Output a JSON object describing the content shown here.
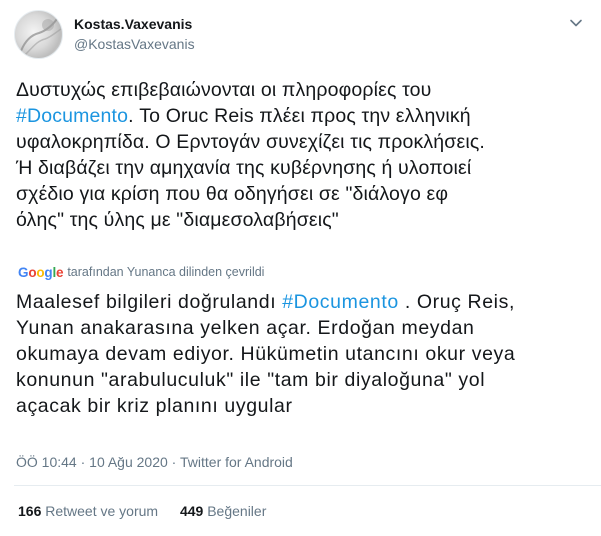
{
  "author": {
    "display_name": "Kostas.Vaxevanis",
    "handle": "@KostasVaxevanis"
  },
  "tweet": {
    "lines": [
      {
        "pre": "Δυστυχώς επιβεβαιώνονται οι πληροφορίες του",
        "tag": "",
        "post": ""
      },
      {
        "pre": "",
        "tag": "#Documento",
        "post": ". Το Oruc Reis πλέει προς την ελληνική"
      },
      {
        "pre": "υφαλοκρηπίδα. Ο Ερντογάν συνεχίζει τις προκλήσεις.",
        "tag": "",
        "post": ""
      },
      {
        "pre": "Ή διαβάζει την αμηχανία της κυβέρνησης ή υλοποιεί",
        "tag": "",
        "post": ""
      },
      {
        "pre": "σχέδιο για κρίση που θα οδηγήσει σε \"διάλογο εφ",
        "tag": "",
        "post": ""
      },
      {
        "pre": "όλης\" της ύλης με \"διαμεσολαβήσεις\"",
        "tag": "",
        "post": ""
      }
    ]
  },
  "translation": {
    "google_logo": [
      "G",
      "o",
      "o",
      "g",
      "l",
      "e"
    ],
    "label": "tarafından Yunanca dilinden çevrildi",
    "lines": [
      {
        "pre": "Maalesef bilgileri doğrulandı ",
        "tag": "#Documento",
        "post": " . Oruç Reis,"
      },
      {
        "pre": "Yunan anakarasına yelken açar. Erdoğan meydan",
        "tag": "",
        "post": ""
      },
      {
        "pre": "okumaya devam ediyor. Hükümetin utancını okur veya",
        "tag": "",
        "post": ""
      },
      {
        "pre": "konunun \"arabuluculuk\" ile \"tam bir diyaloğuna\" yol",
        "tag": "",
        "post": ""
      },
      {
        "pre": "açacak bir kriz planını uygular",
        "tag": "",
        "post": ""
      }
    ]
  },
  "meta": {
    "time": "ÖÖ 10:44",
    "separator": " · ",
    "date": "10 Ağu 2020",
    "source": "Twitter for Android"
  },
  "stats": {
    "retweets_count": "166",
    "retweets_label": "Retweet ve yorum",
    "likes_count": "449",
    "likes_label": "Beğeniler"
  },
  "colors": {
    "link": "#1b95e0",
    "secondary_text": "#657786",
    "divider": "#e6ecf0"
  },
  "icons": {
    "menu": "chevron-down-icon"
  }
}
